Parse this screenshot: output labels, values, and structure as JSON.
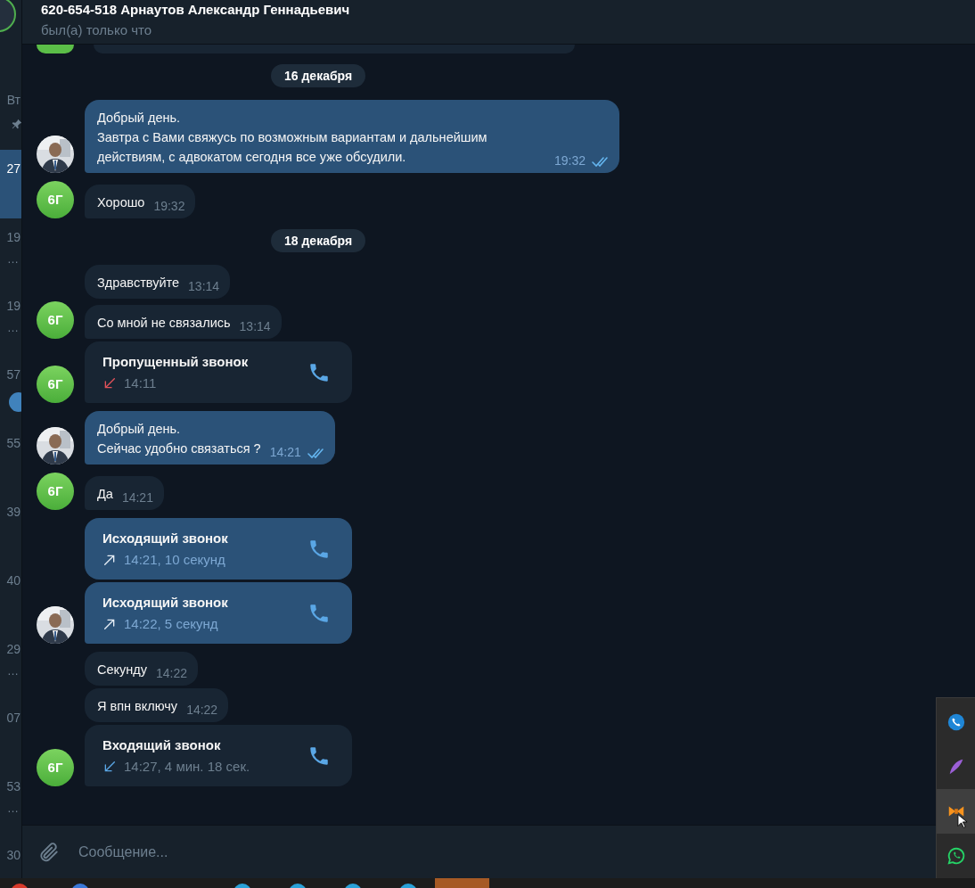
{
  "chat_list": [
    {
      "time": "Вт",
      "pinned": true,
      "selected": false
    },
    {
      "time": "27",
      "selected": true
    },
    {
      "time": "19",
      "preview": "…",
      "selected": false
    },
    {
      "time": "19",
      "preview": "…",
      "selected": false
    },
    {
      "time": "57",
      "unread": true,
      "selected": false
    },
    {
      "time": "55",
      "selected": false
    },
    {
      "time": "39",
      "selected": false
    },
    {
      "time": "40",
      "selected": false
    },
    {
      "time": "29",
      "preview": "…",
      "selected": false
    },
    {
      "time": "07",
      "selected": false
    },
    {
      "time": "53",
      "preview": "…",
      "selected": false
    },
    {
      "time": "30",
      "selected": false
    }
  ],
  "header": {
    "title": "620-654-518 Арнаутов Александр Геннадьевич",
    "status": "был(а) только что"
  },
  "messages": [
    {
      "kind": "stub",
      "outgoing": false
    },
    {
      "kind": "date",
      "text": "16 декабря"
    },
    {
      "kind": "text",
      "outgoing": true,
      "lines": [
        "Добрый день.",
        "Завтра с Вами свяжусь по возможным вариантам и дальнейшим действиям, с адвокатом сегодня все уже обсудили."
      ],
      "time": "19:32",
      "read": true
    },
    {
      "kind": "text",
      "outgoing": false,
      "lines": [
        "Хорошо"
      ],
      "time": "19:32",
      "avatar": {
        "kind": "initials",
        "text": "6Г"
      }
    },
    {
      "kind": "date",
      "text": "18 декабря"
    },
    {
      "kind": "text",
      "outgoing": false,
      "lines": [
        "Здравствуйте"
      ],
      "time": "13:14"
    },
    {
      "kind": "text",
      "outgoing": false,
      "lines": [
        "Со мной не связались"
      ],
      "time": "13:14",
      "avatar": {
        "kind": "initials",
        "text": "6Г"
      }
    },
    {
      "kind": "call",
      "outgoing": false,
      "title": "Пропущенный звонок",
      "missed": true,
      "detail": "14:11",
      "avatar": {
        "kind": "initials",
        "text": "6Г"
      }
    },
    {
      "kind": "text",
      "outgoing": true,
      "lines": [
        "Добрый день.",
        "Сейчас удобно связаться ?"
      ],
      "time": "14:21",
      "read": true
    },
    {
      "kind": "text",
      "outgoing": false,
      "lines": [
        "Да"
      ],
      "time": "14:21",
      "avatar": {
        "kind": "initials",
        "text": "6Г"
      }
    },
    {
      "kind": "call",
      "outgoing": true,
      "title": "Исходящий звонок",
      "missed": false,
      "detail": "14:21, 10 секунд"
    },
    {
      "kind": "call",
      "outgoing": true,
      "title": "Исходящий звонок",
      "missed": false,
      "detail": "14:22, 5 секунд"
    },
    {
      "kind": "text",
      "outgoing": false,
      "lines": [
        "Секунду"
      ],
      "time": "14:22"
    },
    {
      "kind": "text",
      "outgoing": false,
      "lines": [
        "Я впн включу"
      ],
      "time": "14:22"
    },
    {
      "kind": "call",
      "outgoing": false,
      "title": "Входящий звонок",
      "missed": false,
      "detail": "14:27, 4 мин. 18 сек.",
      "avatar": {
        "kind": "initials",
        "text": "6Г"
      }
    }
  ],
  "composer": {
    "placeholder": "Сообщение..."
  },
  "tray": [
    {
      "kind": "phone",
      "selected": false
    },
    {
      "kind": "feather",
      "selected": false
    },
    {
      "kind": "bowtie",
      "selected": true
    },
    {
      "kind": "whatsapp",
      "selected": false
    }
  ]
}
